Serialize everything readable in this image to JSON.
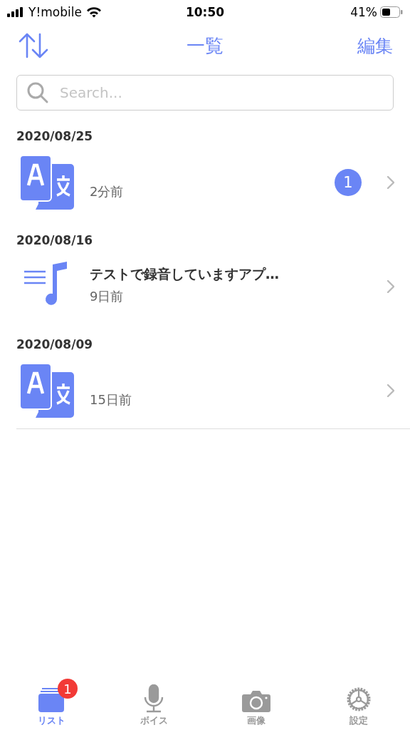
{
  "status_bar": {
    "carrier": "Y!mobile",
    "time": "10:50",
    "battery": "41%"
  },
  "nav": {
    "title": "一覧",
    "edit": "編集"
  },
  "search": {
    "placeholder": "Search..."
  },
  "sections": [
    {
      "date": "2020/08/25",
      "items": [
        {
          "kind": "translate",
          "subtitle": "2分前",
          "badge": "1"
        }
      ]
    },
    {
      "date": "2020/08/16",
      "items": [
        {
          "kind": "audio",
          "title": "テストで録音していますアプ…",
          "subtitle": "9日前"
        }
      ]
    },
    {
      "date": "2020/08/09",
      "items": [
        {
          "kind": "translate",
          "subtitle": "15日前"
        }
      ]
    }
  ],
  "tabs": [
    {
      "kind": "list",
      "label": "リスト",
      "selected": true,
      "badge": "1"
    },
    {
      "kind": "voice",
      "label": "ボイス",
      "selected": false
    },
    {
      "kind": "image",
      "label": "画像",
      "selected": false
    },
    {
      "kind": "settings",
      "label": "設定",
      "selected": false
    }
  ]
}
